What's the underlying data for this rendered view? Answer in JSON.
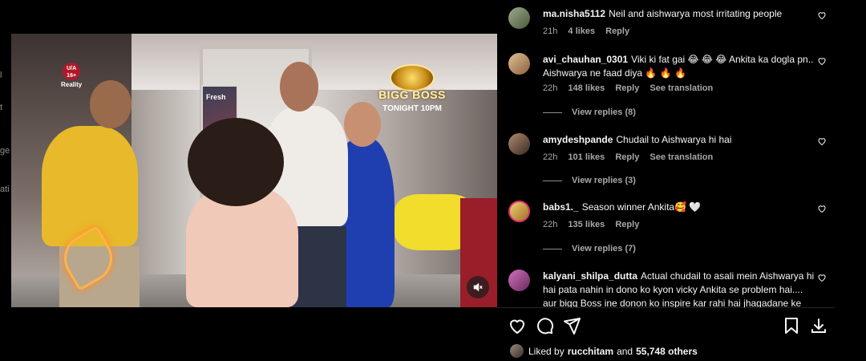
{
  "left_strip": {
    "fragments": [
      "l",
      "t",
      "ge",
      "ati"
    ]
  },
  "video": {
    "rating_badge": "U/A 16+",
    "rating_label": "Reality",
    "poster_text": "Fresh",
    "show_logo": "BIGG BOSS",
    "airtime": "TONIGHT 10PM",
    "mute_icon": "speaker-muted-icon"
  },
  "comments": [
    {
      "user": "ma.nisha5112",
      "text": "Neil and aishwarya most irritating people",
      "time": "21h",
      "likes": "4 likes",
      "reply": "Reply",
      "avatar_color": "#7a8a6a"
    },
    {
      "user": "avi_chauhan_0301",
      "text": "Viki ki fat gai 😂 😂 😂 Ankita ka dogla pn.. Aishwarya ne faad diya 🔥 🔥 🔥",
      "time": "22h",
      "likes": "148 likes",
      "reply": "Reply",
      "translation": "See translation",
      "replies": "View replies (8)",
      "avatar_color": "#c9a070"
    },
    {
      "user": "amydeshpande",
      "text": "Chudail to Aishwarya hi hai",
      "time": "22h",
      "likes": "101 likes",
      "reply": "Reply",
      "translation": "See translation",
      "replies": "View replies (3)",
      "avatar_color": "#6b4a3a"
    },
    {
      "user": "babs1._",
      "text": "Season winner Ankita🥰 🤍",
      "time": "22h",
      "likes": "135 likes",
      "reply": "Reply",
      "replies": "View replies (7)",
      "avatar_color": "#c8a24a"
    },
    {
      "user": "kalyani_shilpa_dutta",
      "text": "Actual chudail to asali mein Aishwarya hi hai pata nahin in dono ko kyon vicky Ankita se problem hai.... aur bigg Boss ine donon ko inspire kar rahi hai jhagadane ke",
      "avatar_color": "#b05a9a"
    }
  ],
  "actions": {
    "like": "heart-icon",
    "comment": "comment-icon",
    "share": "share-icon",
    "save": "bookmark-icon",
    "download": "download-icon"
  },
  "likes_bar": {
    "prefix": "Liked by",
    "user": "rucchitam",
    "joiner": "and",
    "others": "55,748 others"
  }
}
